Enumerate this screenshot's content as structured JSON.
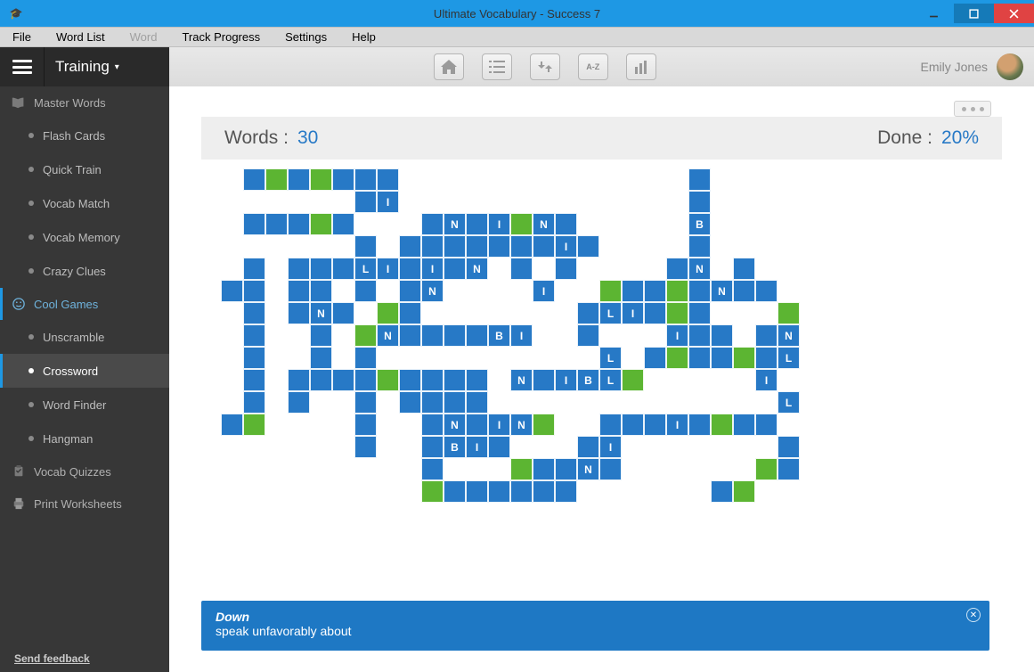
{
  "window": {
    "title": "Ultimate Vocabulary - Success 7"
  },
  "menus": [
    "File",
    "Word List",
    "Word",
    "Track Progress",
    "Settings",
    "Help"
  ],
  "dropdown_label": "Training",
  "user_name": "Emily Jones",
  "sidebar": {
    "master_words": "Master Words",
    "cool_games": "Cool Games",
    "vocab_quizzes": "Vocab Quizzes",
    "print_worksheets": "Print Worksheets",
    "items_master": [
      "Flash Cards",
      "Quick Train",
      "Vocab Match",
      "Vocab Memory",
      "Crazy Clues"
    ],
    "items_games": [
      "Unscramble",
      "Crossword",
      "Word Finder",
      "Hangman"
    ],
    "feedback": "Send feedback"
  },
  "stats": {
    "words_label": "Words  :",
    "words_value": "30",
    "done_label": "Done  :",
    "done_value": "20%"
  },
  "clue": {
    "direction": "Down",
    "text": "speak unfavorably about"
  },
  "crossword": [
    ".bgbgbbb.............b....",
    "......bI.............b....",
    ".bbbgb...bNbIgNb.....B....",
    "......b.bbbbbbbIb....b....",
    ".b.bbbLIbIbN.b.b....bN.b..",
    "bb.bb.b.bN....I..gbbgbNbb.",
    ".b.bNb.gb.......bLIbgb...g",
    ".b..b.gNbbbbBI..b...Ibb.bN",
    ".b..b.b..........L.bgbbgbL",
    ".b.bbbbgbbbb.NbIBLg.....I.",
    ".b.b..b.bbbb.............L",
    "bg....b..bNbINg..bbbIbgbb.",
    "......b..bBIb...bI.......b",
    ".........b...gbbNb......gb",
    ".........gbbbbbb......bg.."
  ]
}
